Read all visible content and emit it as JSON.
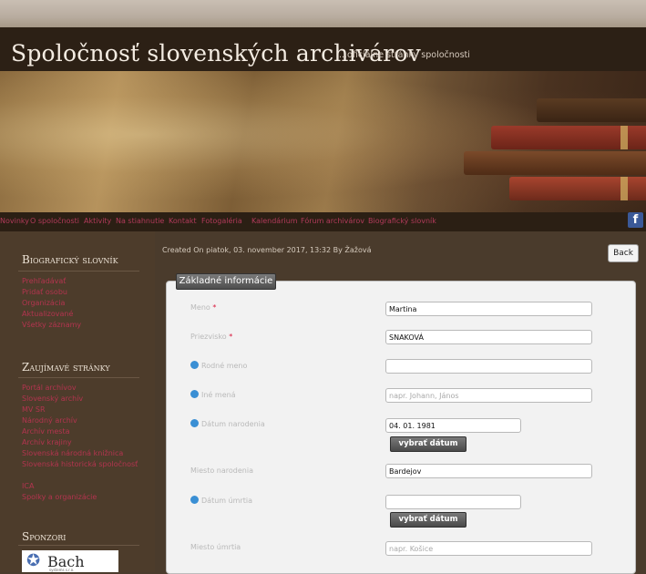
{
  "site": {
    "title": "Spoločnosť slovenských archivárov",
    "subtitle": "...oficiálne stránky spoločnosti"
  },
  "nav": {
    "items": [
      "Novinky",
      "O spoločnosti",
      "Aktivity",
      "Na stiahnutie",
      "Kontakt",
      "Fotogaléria",
      "Kalendárium",
      "Fórum archivárov",
      "Biografický slovník"
    ],
    "facebook_icon": "facebook-icon"
  },
  "sidebar": {
    "section1_title": "Biografický slovník",
    "section1_links": [
      "Prehľadávať",
      "Pridať osobu",
      "Organizácia",
      "Aktualizované",
      "Všetky záznamy"
    ],
    "section2_title": "Zaujímavé stránky",
    "section2_links": [
      "Portál archívov",
      "Slovenský archív",
      "MV SR",
      "Národný archív",
      "Archív mesta",
      "Archív krajiny",
      "Slovenská národná knižnica",
      "Slovenská historická spoločnosť",
      "ICA",
      "Spolky a organizácie"
    ],
    "section3_title": "Sponzori",
    "sponsor_name": "Bach",
    "sponsor_sub": "systems s.r.o."
  },
  "content": {
    "created_line": "Created On piatok, 03. november 2017, 13:32 By Žažová",
    "back_label": "Back",
    "legend": "Základné informácie",
    "date_button": "vybrať dátum",
    "fields": {
      "meno_label": "Meno",
      "meno_value": "Martina",
      "priezvisko_label": "Priezvisko",
      "priezvisko_value": "SNAKOVÁ",
      "rodne_label": "Rodné meno",
      "rodne_value": "",
      "ine_label": "Iné mená",
      "ine_placeholder": "napr. Johann, János",
      "datum_nar_label": "Dátum narodenia",
      "datum_nar_value": "04. 01. 1981",
      "miesto_nar_label": "Miesto narodenia",
      "miesto_nar_value": "Bardejov",
      "datum_umr_label": "Dátum úmrtia",
      "datum_umr_value": "",
      "miesto_umr_label": "Miesto úmrtia",
      "miesto_umr_placeholder": "napr. Košice",
      "required_mark": "*"
    }
  },
  "colors": {
    "header_bg": "#2c2015",
    "sidebar_bg": "#4d3c2b",
    "link_red": "#b3344f",
    "required_red": "#d8173b",
    "info_blue": "#3a8fd4"
  }
}
